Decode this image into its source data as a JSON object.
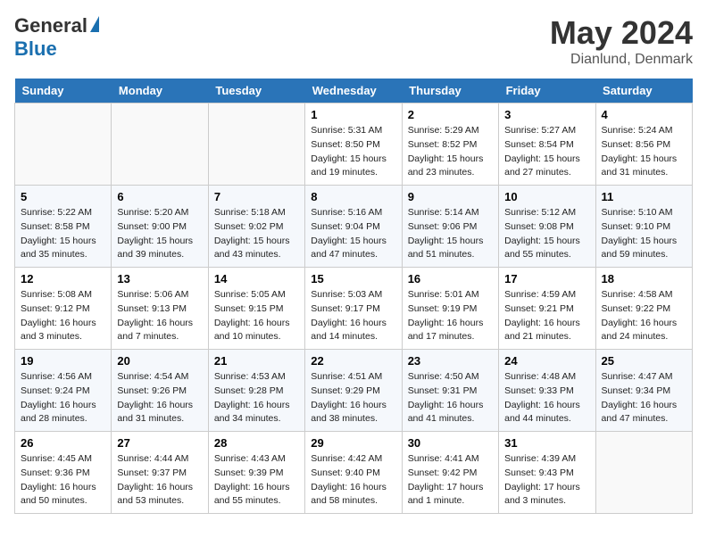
{
  "header": {
    "logo": {
      "general": "General",
      "blue": "Blue"
    },
    "title": "May 2024",
    "location": "Dianlund, Denmark"
  },
  "days_of_week": [
    "Sunday",
    "Monday",
    "Tuesday",
    "Wednesday",
    "Thursday",
    "Friday",
    "Saturday"
  ],
  "weeks": [
    [
      {
        "day": "",
        "info": ""
      },
      {
        "day": "",
        "info": ""
      },
      {
        "day": "",
        "info": ""
      },
      {
        "day": "1",
        "info": "Sunrise: 5:31 AM\nSunset: 8:50 PM\nDaylight: 15 hours\nand 19 minutes."
      },
      {
        "day": "2",
        "info": "Sunrise: 5:29 AM\nSunset: 8:52 PM\nDaylight: 15 hours\nand 23 minutes."
      },
      {
        "day": "3",
        "info": "Sunrise: 5:27 AM\nSunset: 8:54 PM\nDaylight: 15 hours\nand 27 minutes."
      },
      {
        "day": "4",
        "info": "Sunrise: 5:24 AM\nSunset: 8:56 PM\nDaylight: 15 hours\nand 31 minutes."
      }
    ],
    [
      {
        "day": "5",
        "info": "Sunrise: 5:22 AM\nSunset: 8:58 PM\nDaylight: 15 hours\nand 35 minutes."
      },
      {
        "day": "6",
        "info": "Sunrise: 5:20 AM\nSunset: 9:00 PM\nDaylight: 15 hours\nand 39 minutes."
      },
      {
        "day": "7",
        "info": "Sunrise: 5:18 AM\nSunset: 9:02 PM\nDaylight: 15 hours\nand 43 minutes."
      },
      {
        "day": "8",
        "info": "Sunrise: 5:16 AM\nSunset: 9:04 PM\nDaylight: 15 hours\nand 47 minutes."
      },
      {
        "day": "9",
        "info": "Sunrise: 5:14 AM\nSunset: 9:06 PM\nDaylight: 15 hours\nand 51 minutes."
      },
      {
        "day": "10",
        "info": "Sunrise: 5:12 AM\nSunset: 9:08 PM\nDaylight: 15 hours\nand 55 minutes."
      },
      {
        "day": "11",
        "info": "Sunrise: 5:10 AM\nSunset: 9:10 PM\nDaylight: 15 hours\nand 59 minutes."
      }
    ],
    [
      {
        "day": "12",
        "info": "Sunrise: 5:08 AM\nSunset: 9:12 PM\nDaylight: 16 hours\nand 3 minutes."
      },
      {
        "day": "13",
        "info": "Sunrise: 5:06 AM\nSunset: 9:13 PM\nDaylight: 16 hours\nand 7 minutes."
      },
      {
        "day": "14",
        "info": "Sunrise: 5:05 AM\nSunset: 9:15 PM\nDaylight: 16 hours\nand 10 minutes."
      },
      {
        "day": "15",
        "info": "Sunrise: 5:03 AM\nSunset: 9:17 PM\nDaylight: 16 hours\nand 14 minutes."
      },
      {
        "day": "16",
        "info": "Sunrise: 5:01 AM\nSunset: 9:19 PM\nDaylight: 16 hours\nand 17 minutes."
      },
      {
        "day": "17",
        "info": "Sunrise: 4:59 AM\nSunset: 9:21 PM\nDaylight: 16 hours\nand 21 minutes."
      },
      {
        "day": "18",
        "info": "Sunrise: 4:58 AM\nSunset: 9:22 PM\nDaylight: 16 hours\nand 24 minutes."
      }
    ],
    [
      {
        "day": "19",
        "info": "Sunrise: 4:56 AM\nSunset: 9:24 PM\nDaylight: 16 hours\nand 28 minutes."
      },
      {
        "day": "20",
        "info": "Sunrise: 4:54 AM\nSunset: 9:26 PM\nDaylight: 16 hours\nand 31 minutes."
      },
      {
        "day": "21",
        "info": "Sunrise: 4:53 AM\nSunset: 9:28 PM\nDaylight: 16 hours\nand 34 minutes."
      },
      {
        "day": "22",
        "info": "Sunrise: 4:51 AM\nSunset: 9:29 PM\nDaylight: 16 hours\nand 38 minutes."
      },
      {
        "day": "23",
        "info": "Sunrise: 4:50 AM\nSunset: 9:31 PM\nDaylight: 16 hours\nand 41 minutes."
      },
      {
        "day": "24",
        "info": "Sunrise: 4:48 AM\nSunset: 9:33 PM\nDaylight: 16 hours\nand 44 minutes."
      },
      {
        "day": "25",
        "info": "Sunrise: 4:47 AM\nSunset: 9:34 PM\nDaylight: 16 hours\nand 47 minutes."
      }
    ],
    [
      {
        "day": "26",
        "info": "Sunrise: 4:45 AM\nSunset: 9:36 PM\nDaylight: 16 hours\nand 50 minutes."
      },
      {
        "day": "27",
        "info": "Sunrise: 4:44 AM\nSunset: 9:37 PM\nDaylight: 16 hours\nand 53 minutes."
      },
      {
        "day": "28",
        "info": "Sunrise: 4:43 AM\nSunset: 9:39 PM\nDaylight: 16 hours\nand 55 minutes."
      },
      {
        "day": "29",
        "info": "Sunrise: 4:42 AM\nSunset: 9:40 PM\nDaylight: 16 hours\nand 58 minutes."
      },
      {
        "day": "30",
        "info": "Sunrise: 4:41 AM\nSunset: 9:42 PM\nDaylight: 17 hours\nand 1 minute."
      },
      {
        "day": "31",
        "info": "Sunrise: 4:39 AM\nSunset: 9:43 PM\nDaylight: 17 hours\nand 3 minutes."
      },
      {
        "day": "",
        "info": ""
      }
    ]
  ]
}
